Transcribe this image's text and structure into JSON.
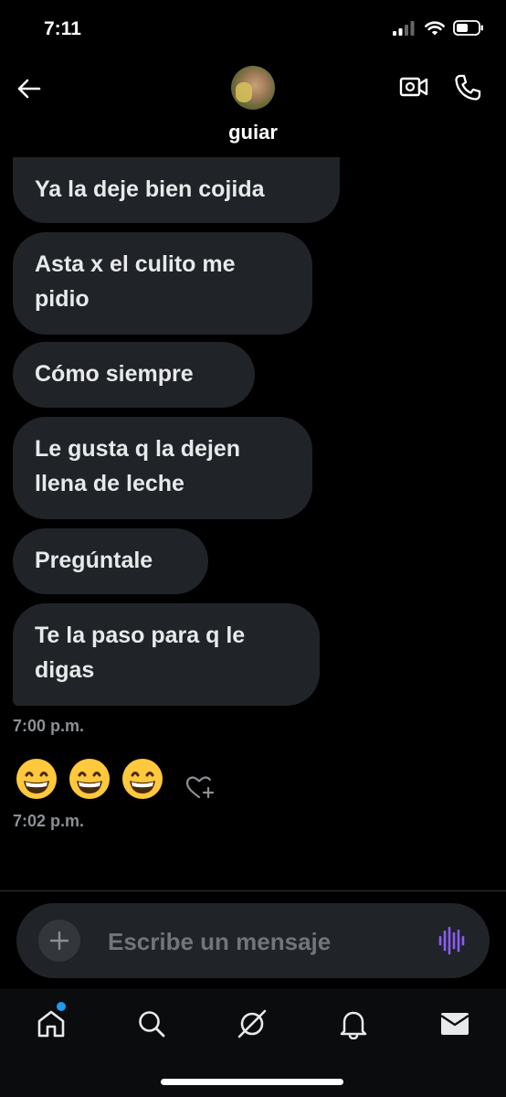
{
  "status_bar": {
    "time": "7:11",
    "icons": [
      "signal-icon",
      "wifi-icon",
      "battery-icon"
    ]
  },
  "header": {
    "contact_name": "guiar",
    "icons": {
      "back": "arrow-left-icon",
      "video": "video-camera-icon",
      "call": "phone-icon"
    }
  },
  "messages": [
    {
      "text": "Ya la deje bien cojida"
    },
    {
      "text": "Asta x el culito me pidio"
    },
    {
      "text": "Cómo siempre"
    },
    {
      "text": "Le gusta q la dejen llena de leche"
    },
    {
      "text": "Pregúntale"
    },
    {
      "text": "Te la paso para q le digas"
    }
  ],
  "timestamps": [
    "7:00 p.m.",
    "7:02 p.m."
  ],
  "emoji_message": "😁😁😁",
  "composer": {
    "placeholder": "Escribe un mensaje"
  },
  "bottom_nav": {
    "items": [
      "home-icon",
      "search-icon",
      "grok-icon",
      "notifications-bell-icon",
      "messages-envelope-icon"
    ],
    "active": "home-icon",
    "has_notification_dot": true
  },
  "colors": {
    "background": "#000000",
    "bubble": "#202327",
    "text": "#e7e9ea",
    "muted": "#8b9096",
    "accent": "#1d9bf0",
    "voice": "#8b5cf6"
  }
}
